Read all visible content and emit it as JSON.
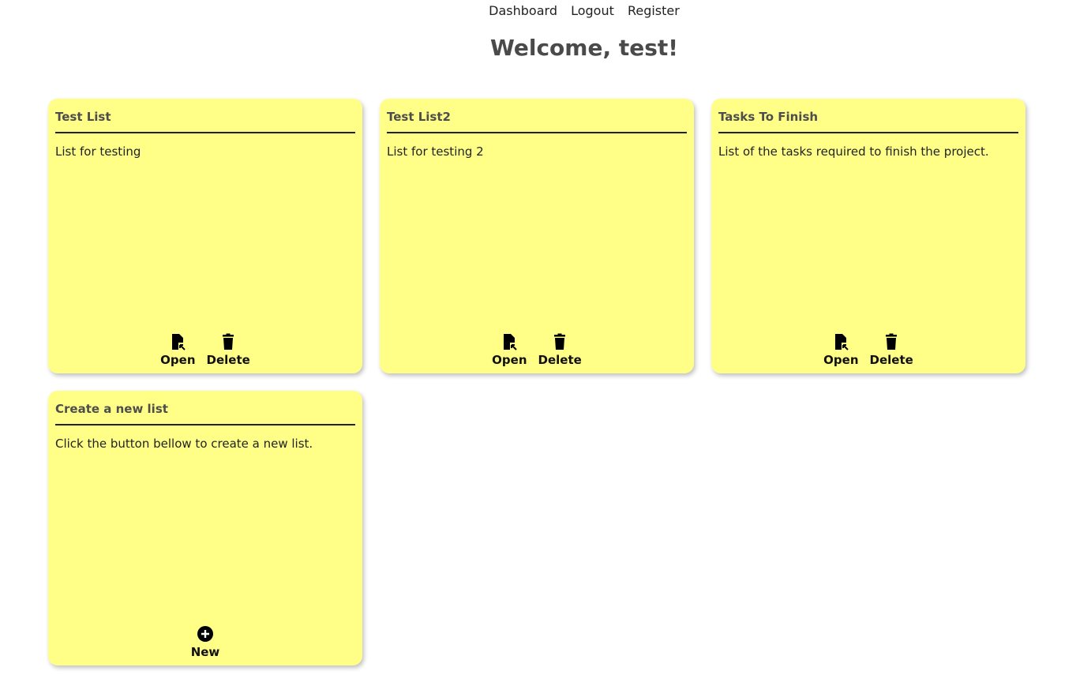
{
  "nav": {
    "items": [
      "Dashboard",
      "Logout",
      "Register"
    ]
  },
  "welcome": "Welcome, test!",
  "colors": {
    "card_bg": "#ffff88",
    "title_text": "#4a4a4a"
  },
  "lists": [
    {
      "title": "Test List",
      "description": "List for testing",
      "open_label": "Open",
      "delete_label": "Delete"
    },
    {
      "title": "Test List2",
      "description": "List for testing 2",
      "open_label": "Open",
      "delete_label": "Delete"
    },
    {
      "title": "Tasks To Finish",
      "description": "List of the tasks required to finish the project.",
      "open_label": "Open",
      "delete_label": "Delete"
    }
  ],
  "new_card": {
    "title": "Create a new list",
    "description": "Click the button bellow to create a new list.",
    "new_label": "New"
  },
  "icons": {
    "open": "file-open-icon",
    "delete": "trash-icon",
    "new": "plus-circle-icon"
  }
}
